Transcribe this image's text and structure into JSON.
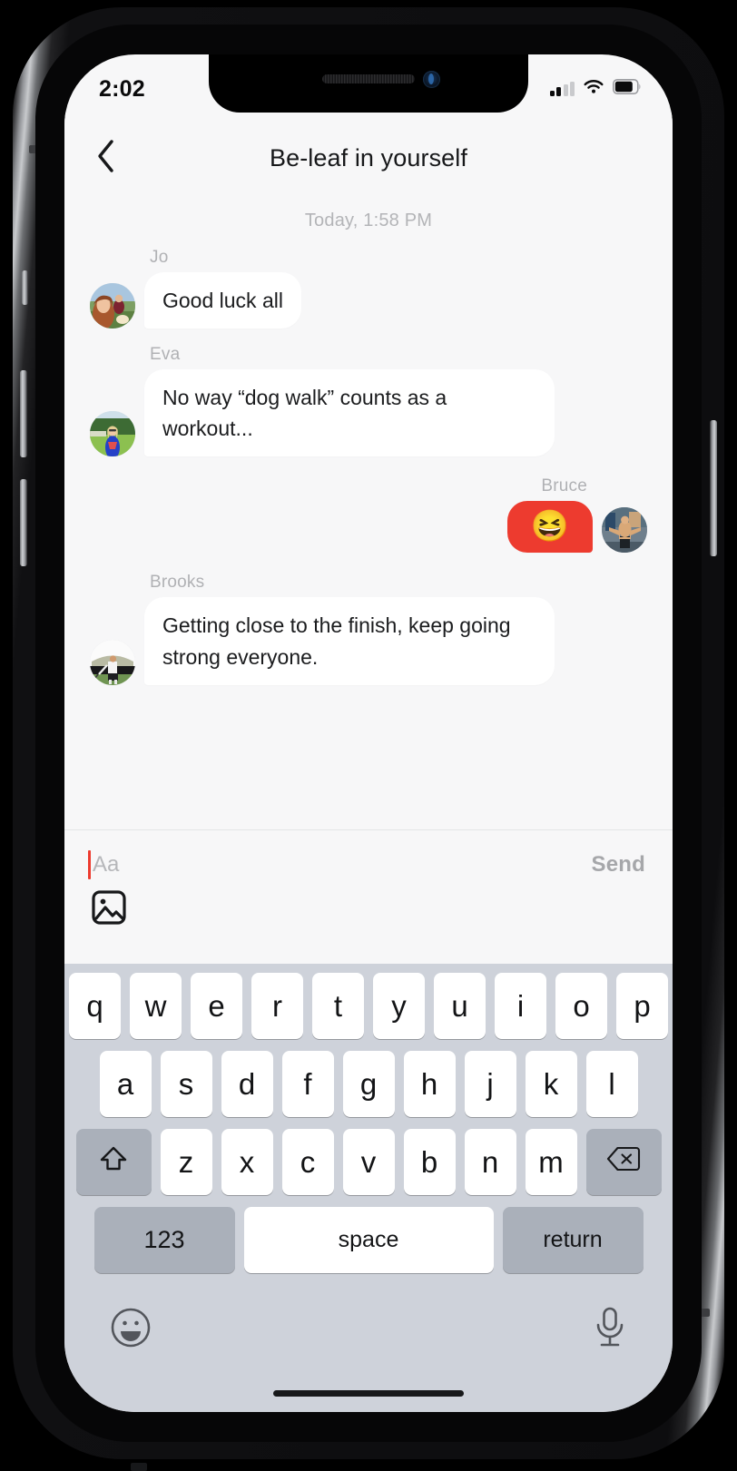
{
  "status_bar": {
    "time": "2:02",
    "signal_icon": "cellular-signal-icon",
    "signal_bars_filled": 2,
    "signal_bars_total": 4,
    "wifi_icon": "wifi-icon",
    "battery_icon": "battery-icon",
    "battery_level_pct": 72
  },
  "header": {
    "back_icon": "chevron-left-icon",
    "title": "Be-leaf in yourself"
  },
  "conversation": {
    "date_divider": "Today, 1:58 PM",
    "messages": [
      {
        "sender": "Jo",
        "text": "Good luck all",
        "direction": "incoming",
        "type": "text"
      },
      {
        "sender": "Eva",
        "text": "No way “dog walk” counts as a workout...",
        "direction": "incoming",
        "type": "text"
      },
      {
        "sender": "Bruce",
        "text": "😆",
        "direction": "outgoing",
        "type": "emoji"
      },
      {
        "sender": "Brooks",
        "text": "Getting close to the finish, keep going strong everyone.",
        "direction": "incoming",
        "type": "text"
      }
    ]
  },
  "input_bar": {
    "placeholder": "Aa",
    "value": "",
    "send_label": "Send",
    "attach_icon": "photo-image-icon",
    "caret_color": "#ed3b2f"
  },
  "keyboard": {
    "row1": [
      "q",
      "w",
      "e",
      "r",
      "t",
      "y",
      "u",
      "i",
      "o",
      "p"
    ],
    "row2": [
      "a",
      "s",
      "d",
      "f",
      "g",
      "h",
      "j",
      "k",
      "l"
    ],
    "row3_letters": [
      "z",
      "x",
      "c",
      "v",
      "b",
      "n",
      "m"
    ],
    "shift_icon": "shift-arrow-up-icon",
    "backspace_icon": "backspace-delete-icon",
    "numeric_label": "123",
    "space_label": "space",
    "return_label": "return",
    "emoji_icon": "smiley-face-icon",
    "mic_icon": "microphone-icon"
  },
  "colors": {
    "accent_red": "#ed3b2f",
    "screen_bg": "#f7f7f8",
    "bubble_bg": "#ffffff",
    "keyboard_bg": "#ced2da",
    "key_bg": "#ffffff",
    "mod_key_bg": "#aab0ba"
  }
}
